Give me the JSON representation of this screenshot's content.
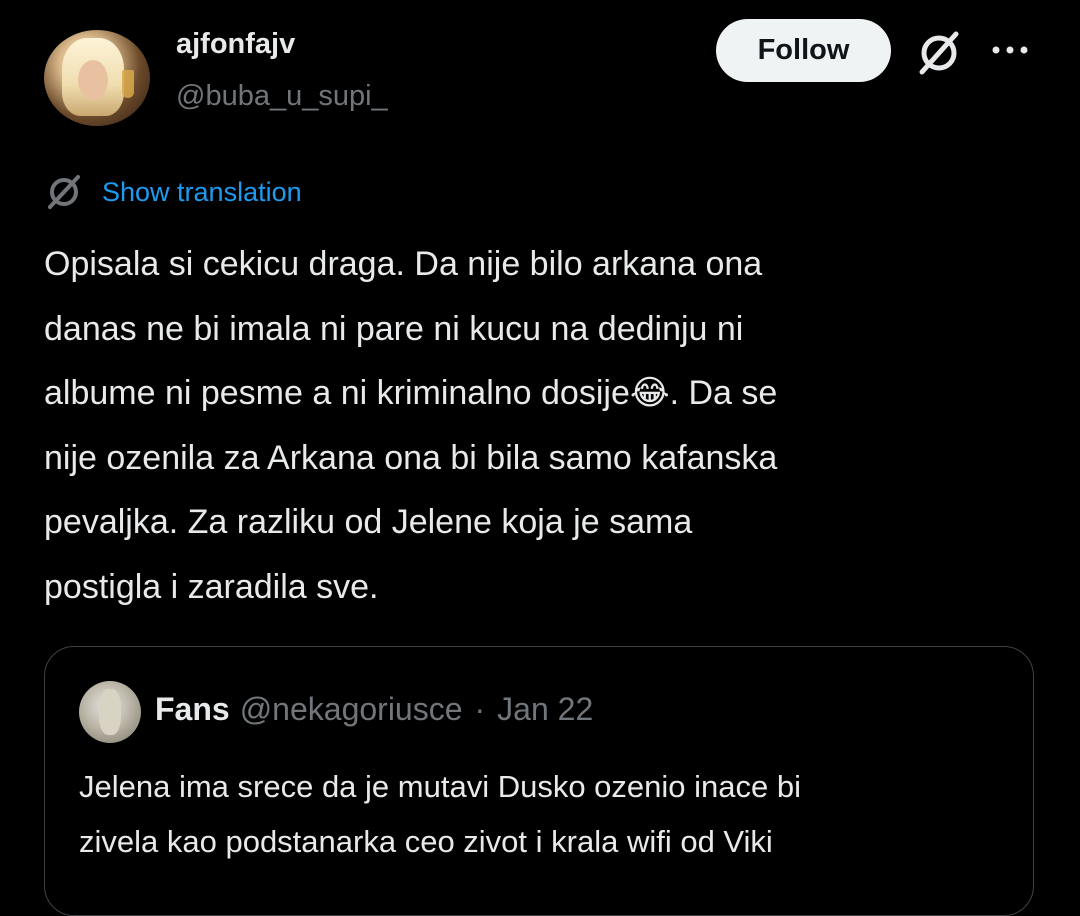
{
  "author": {
    "display_name": "ajfonfajv",
    "handle": "@buba_u_supi_"
  },
  "actions": {
    "follow_label": "Follow",
    "grok_icon": "grok-icon",
    "more_icon": "more-icon"
  },
  "translation": {
    "label": "Show translation",
    "icon": "translate-icon"
  },
  "tweet": {
    "text_before_emoji": "Opisala si cekicu draga. Da nije bilo arkana ona\ndanas ne bi imala ni pare ni kucu na dedinju ni\nalbume ni pesme a ni kriminalno dosije",
    "emoji": "😂",
    "text_after_emoji": ". Da se\nnije ozenila za Arkana ona bi bila samo kafanska\npevaljka. Za razliku od Jelene koja je sama\npostigla i zaradila sve."
  },
  "quoted_tweet": {
    "display_name": "Fans",
    "handle": "@nekagoriusce",
    "separator": "·",
    "date": "Jan 22",
    "text": "Jelena ima srece da je mutavi Dusko ozenio inace bi\nzivela kao podstanarka ceo zivot i krala wifi od Viki"
  },
  "colors": {
    "background": "#000000",
    "text_primary": "#e7e9ea",
    "text_secondary": "#71767b",
    "link": "#1d9bf0",
    "follow_bg": "#eff3f4",
    "border": "#3e4144"
  }
}
